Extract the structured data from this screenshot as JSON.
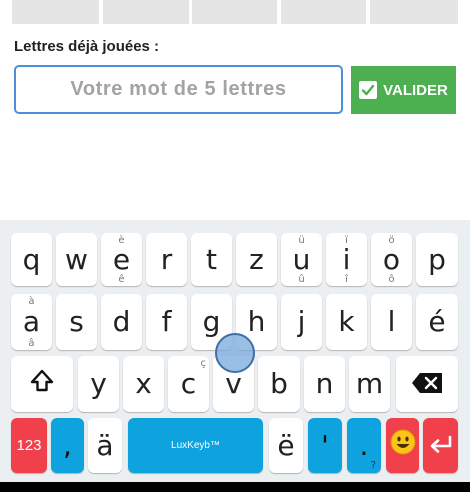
{
  "tiles": [
    "",
    "",
    "",
    "",
    ""
  ],
  "played_letters_label": "Lettres déjà jouées :",
  "word_input": {
    "placeholder": "Votre mot de 5 lettres",
    "value": ""
  },
  "validate_button": {
    "label": "VALIDER",
    "icon": "check-mark-icon",
    "color": "#4caf50"
  },
  "keyboard": {
    "name": "LuxKeyb™",
    "row1": [
      {
        "key": "q"
      },
      {
        "key": "w"
      },
      {
        "key": "e",
        "alt_top": "è",
        "alt_bottom": "ê"
      },
      {
        "key": "r"
      },
      {
        "key": "t"
      },
      {
        "key": "z"
      },
      {
        "key": "u",
        "alt_top": "ü",
        "alt_bottom": "û"
      },
      {
        "key": "i",
        "alt_top": "ï",
        "alt_bottom": "î"
      },
      {
        "key": "o",
        "alt_top": "ö",
        "alt_bottom": "ô"
      },
      {
        "key": "p"
      }
    ],
    "row2": [
      {
        "key": "a",
        "alt_top": "à",
        "alt_bottom": "â"
      },
      {
        "key": "s"
      },
      {
        "key": "d"
      },
      {
        "key": "f"
      },
      {
        "key": "g"
      },
      {
        "key": "h"
      },
      {
        "key": "j"
      },
      {
        "key": "k"
      },
      {
        "key": "l"
      },
      {
        "key": "é"
      }
    ],
    "row3": [
      {
        "key": "y"
      },
      {
        "key": "x"
      },
      {
        "key": "c",
        "alt_top": "ç"
      },
      {
        "key": "v"
      },
      {
        "key": "b"
      },
      {
        "key": "n"
      },
      {
        "key": "m"
      }
    ],
    "row4": {
      "num": "123",
      "comma": ",",
      "a_umlaut": "ä",
      "e_umlaut": "ë",
      "apostrophe": "'",
      "period": ".",
      "question": "?",
      "emoji": "😀"
    },
    "accent_red": "#f0404c",
    "accent_blue": "#0ea2df"
  }
}
